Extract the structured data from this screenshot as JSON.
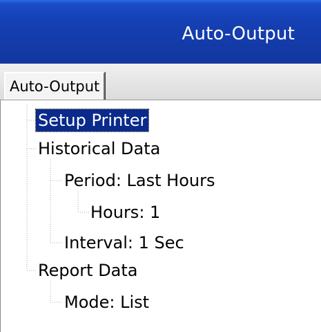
{
  "window": {
    "title": "Auto-Output"
  },
  "tabs": [
    {
      "label": "Auto-Output",
      "active": true
    }
  ],
  "tree": {
    "selected_index": 0,
    "nodes": [
      {
        "label": "Setup Printer",
        "level": 0
      },
      {
        "label": "Historical Data",
        "level": 0
      },
      {
        "label": "Period: Last Hours",
        "level": 1
      },
      {
        "label": "Hours: 1",
        "level": 2
      },
      {
        "label": "Interval: 1 Sec",
        "level": 1
      },
      {
        "label": "Report Data",
        "level": 0
      },
      {
        "label": "Mode: List",
        "level": 1
      }
    ]
  },
  "colors": {
    "title_bar": "#1540b4",
    "selection": "#0a2a8c"
  }
}
